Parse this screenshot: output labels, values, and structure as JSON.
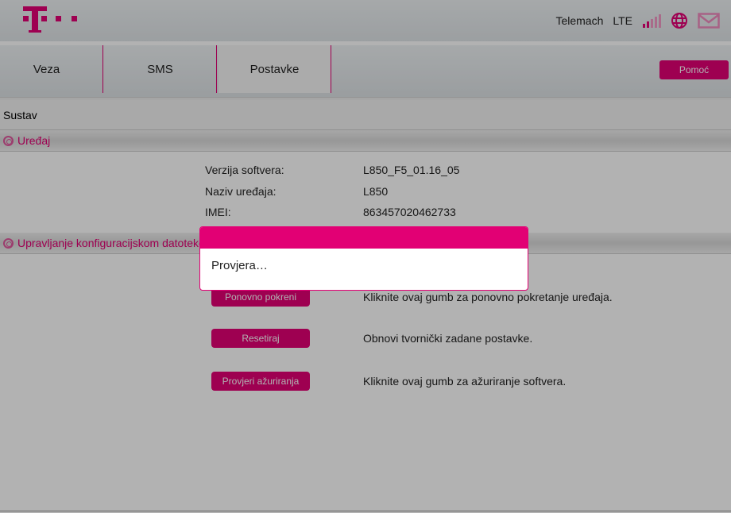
{
  "header": {
    "operator": "Telemach",
    "network": "LTE",
    "signal_bars": 2,
    "signal_max": 5
  },
  "nav": {
    "tabs": [
      {
        "label": "Veza"
      },
      {
        "label": "SMS"
      },
      {
        "label": "Postavke",
        "active": true
      }
    ],
    "help_label": "Pomoć"
  },
  "breadcrumb": "Sustav",
  "device": {
    "title": "Uređaj",
    "rows": [
      {
        "label": "Verzija softvera:",
        "value": "L850_F5_01.16_05"
      },
      {
        "label": "Naziv uređaja:",
        "value": "L850"
      },
      {
        "label": "IMEI:",
        "value": "863457020462733"
      }
    ]
  },
  "config": {
    "title": "Upravljanje konfiguracijskom datotekom",
    "actions": [
      {
        "label": "Ponovno pokreni",
        "desc": "Kliknite ovaj gumb za ponovno pokretanje uređaja."
      },
      {
        "label": "Resetiraj",
        "desc": "Obnovi tvornički zadane postavke."
      },
      {
        "label": "Provjeri ažuriranja",
        "desc": "Kliknite ovaj gumb za ažuriranje softvera."
      }
    ]
  },
  "modal": {
    "message": "Provjera…"
  },
  "colors": {
    "accent": "#e20074"
  }
}
